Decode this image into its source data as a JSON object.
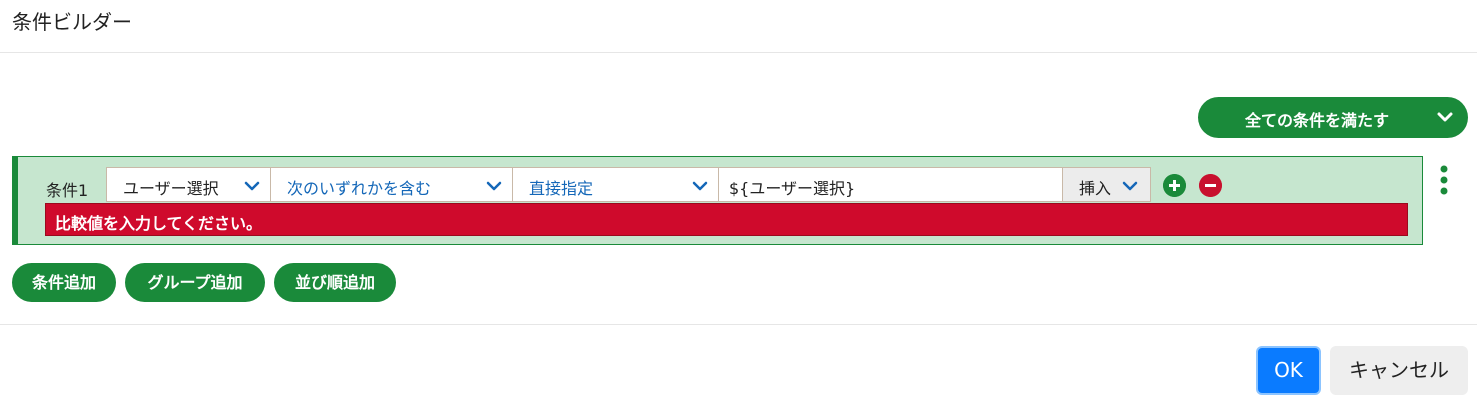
{
  "dialog": {
    "title": "条件ビルダー"
  },
  "match_mode": {
    "label": "全ての条件を満たす",
    "icon": "chevron-down-icon"
  },
  "condition": {
    "label": "条件1",
    "field_select": "ユーザー選択",
    "operator_select": "次のいずれかを含む",
    "value_type_select": "直接指定",
    "value_input": "${ユーザー選択}",
    "insert_label": "挿入",
    "error_message": "比較値を入力してください。"
  },
  "actions": {
    "add_condition": "条件追加",
    "add_group": "グループ追加",
    "add_sort": "並び順追加"
  },
  "footer": {
    "ok": "OK",
    "cancel": "キャンセル"
  },
  "colors": {
    "primary_green": "#1a8a3a",
    "condition_bg": "#c6e6cf",
    "error_red": "#cf0a2c",
    "link_blue": "#1467b8",
    "ok_blue": "#0a7bff"
  }
}
